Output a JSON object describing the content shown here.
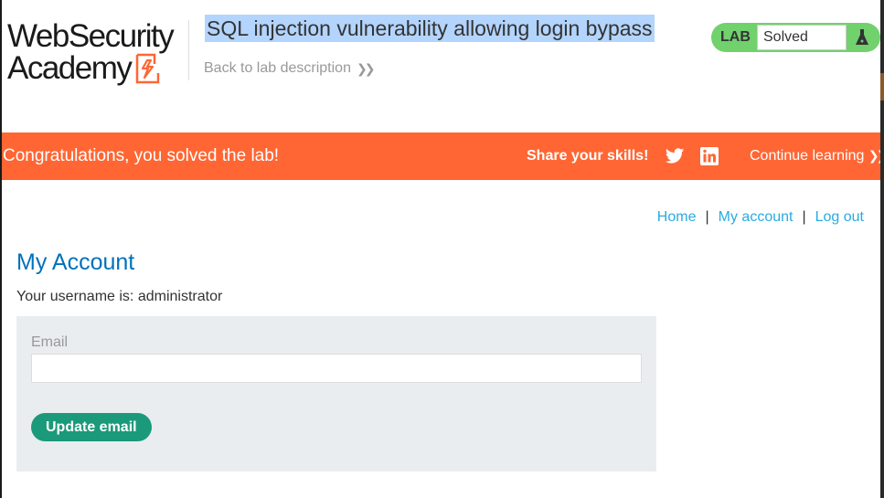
{
  "header": {
    "logo_line1": "WebSecurity",
    "logo_line2": "Academy",
    "lab_title": "SQL injection vulnerability allowing login bypass",
    "back_link": "Back to lab description",
    "lab_badge": {
      "tag": "LAB",
      "status": "Solved"
    }
  },
  "banner": {
    "message": "Congratulations, you solved the lab!",
    "share_label": "Share your skills!",
    "continue_label": "Continue learning",
    "icons": [
      "twitter-icon",
      "linkedin-icon"
    ]
  },
  "nav": {
    "home": "Home",
    "separator": "|",
    "my_account": "My account",
    "log_out": "Log out"
  },
  "main": {
    "title": "My Account",
    "username_line": "Your username is: administrator",
    "email_label": "Email",
    "email_value": "",
    "update_button": "Update email"
  },
  "colors": {
    "accent_orange": "#ff6633",
    "lab_green": "#70d16d",
    "link_blue": "#29abe2",
    "title_blue": "#0071bc",
    "button_green": "#1a9a7a",
    "panel_gray": "#e9edf0",
    "selection_highlight": "#b3d4fc"
  }
}
